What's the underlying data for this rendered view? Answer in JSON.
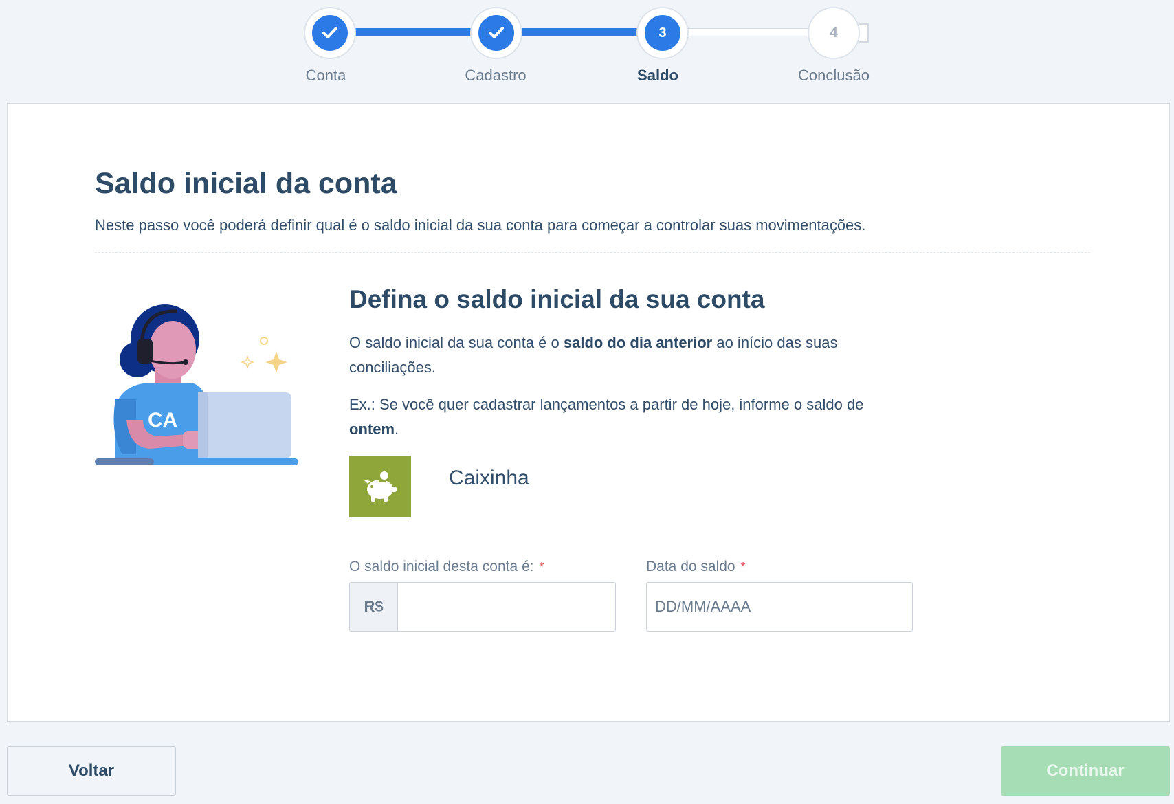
{
  "stepper": {
    "steps": [
      {
        "label": "Conta",
        "state": "done",
        "number": "1"
      },
      {
        "label": "Cadastro",
        "state": "done",
        "number": "2"
      },
      {
        "label": "Saldo",
        "state": "active",
        "number": "3"
      },
      {
        "label": "Conclusão",
        "state": "pending",
        "number": "4"
      }
    ],
    "colors": {
      "active": "#2c7ae6",
      "pending": "#ffffff"
    }
  },
  "main": {
    "title": "Saldo inicial da conta",
    "description": "Neste passo você poderá definir qual é o saldo inicial da sua conta para começar a controlar suas movimentações.",
    "illustration": {
      "badge_text": "CA",
      "icon": "support-agent-illustration"
    },
    "section": {
      "title": "Defina o saldo inicial da sua conta",
      "p1_a": "O saldo inicial da sua conta é o ",
      "p1_bold": "saldo do dia anterior",
      "p1_b": " ao início das suas conciliações.",
      "p2_a": "Ex.: Se você quer cadastrar lançamentos a partir de hoje, informe o saldo de ",
      "p2_bold": "ontem",
      "p2_b": "."
    },
    "account": {
      "name": "Caixinha",
      "icon": "piggy-bank-icon",
      "color": "#8fa63a"
    },
    "form": {
      "saldo_label": "O saldo inicial desta conta é:",
      "saldo_prefix": "R$",
      "saldo_value": "",
      "data_label": "Data do saldo",
      "data_placeholder": "DD/MM/AAAA",
      "required_mark": "*"
    }
  },
  "footer": {
    "back_label": "Voltar",
    "next_label": "Continuar",
    "next_color": "#a6ddb4"
  }
}
